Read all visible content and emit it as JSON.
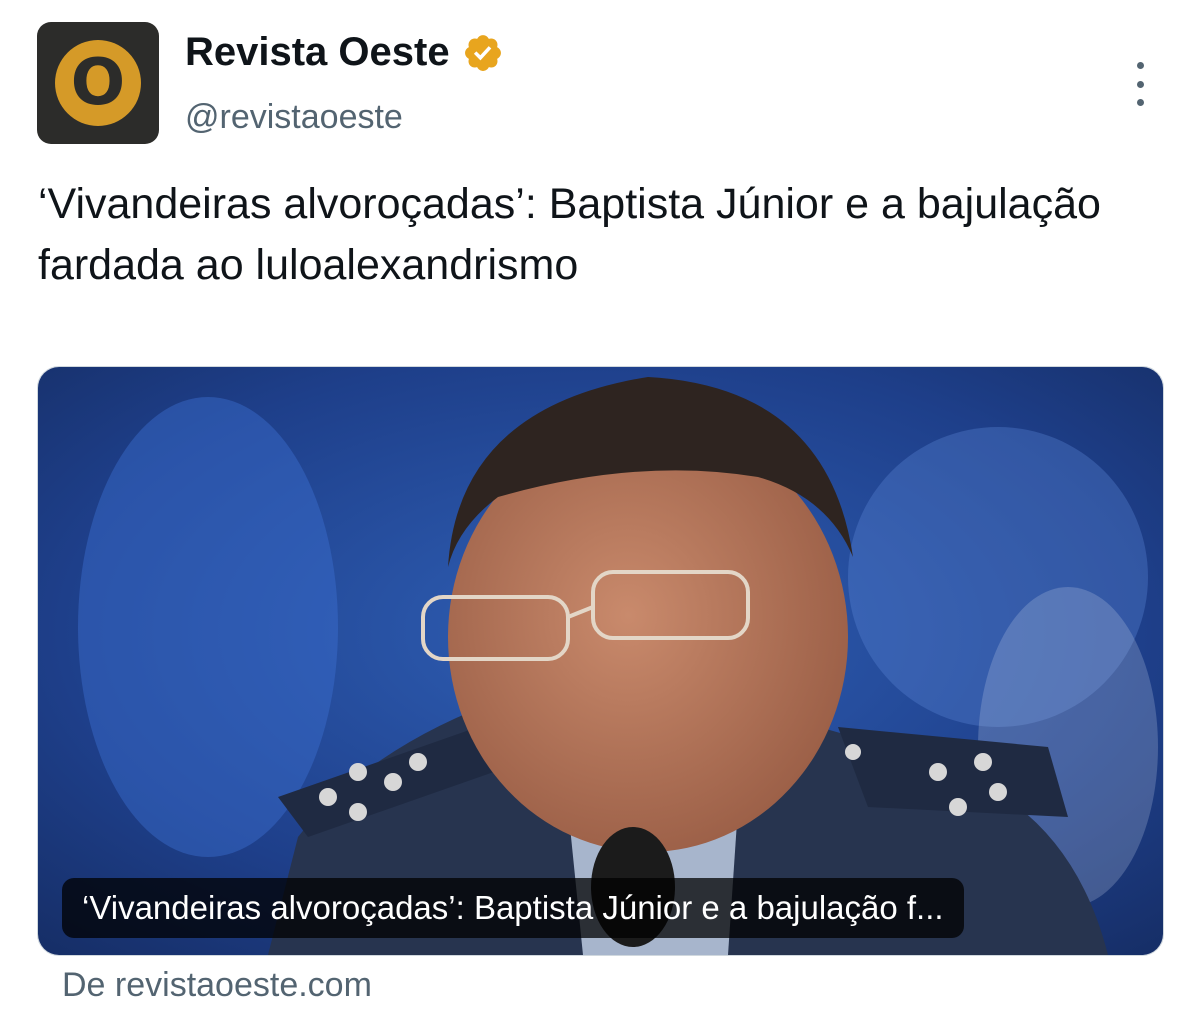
{
  "account": {
    "display_name": "Revista Oeste",
    "handle": "@revistaoeste",
    "avatar_letter": "O",
    "verified": true,
    "verified_color": "#e8a51e"
  },
  "tweet": {
    "text": "‘Vivandeiras alvoroçadas’: Baptista Júnior e a bajulação fardada ao luloalexandrismo"
  },
  "card": {
    "caption": "‘Vivandeiras alvoroçadas’: Baptista Júnior e a bajulação f...",
    "source": "De revistaoeste.com"
  },
  "icons": {
    "verified": "verified-badge-icon",
    "more": "more-vertical-icon"
  },
  "colors": {
    "avatar_bg": "#2c2c2a",
    "avatar_accent": "#d59a28",
    "muted_text": "#536471"
  }
}
